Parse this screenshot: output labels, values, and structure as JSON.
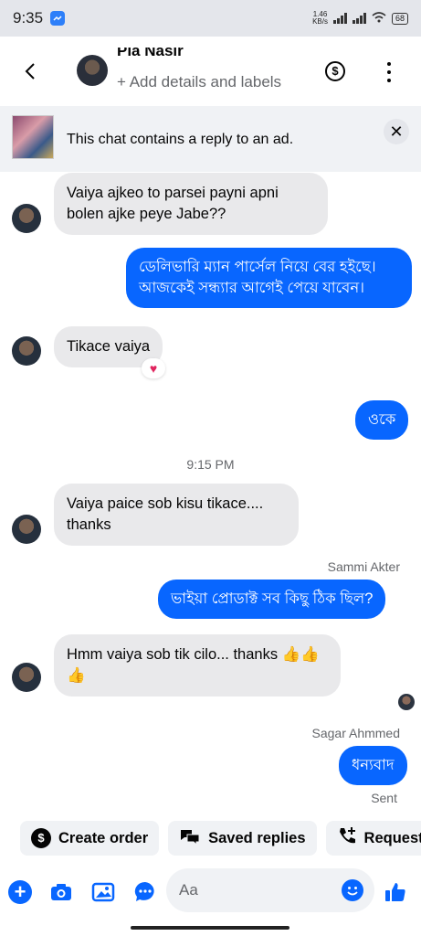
{
  "status": {
    "time": "9:35",
    "net_speed": "1.46\nKB/s",
    "battery": "68"
  },
  "header": {
    "name": "Pia Nasir",
    "subtitle": "+ Add details and labels"
  },
  "ad_banner": {
    "text": "This chat contains a reply to an ad.",
    "close": "✕"
  },
  "messages": {
    "m1": "Vaiya ajkeo to parsei payni   apni bolen ajke peye Jabe??",
    "m2": "ডেলিভারি ম্যান পার্সেল নিয়ে বের হইছে। আজকেই  সন্ধ্যার আগেই পেয়ে যাবেন।",
    "m3": "Tikace vaiya",
    "m3_reaction": "♥",
    "m4": "ওকে",
    "timestamp": "9:15 PM",
    "m5": "Vaiya paice sob kisu tikace.... thanks",
    "m6_sender": "Sammi Akter",
    "m6": "ভাইয়া প্রোডাক্ট সব কিছু ঠিক ছিল?",
    "m7": "Hmm vaiya sob tik cilo... thanks 👍👍👍",
    "m8_sender": "Sagar Ahmmed",
    "m8": "ধন্যবাদ",
    "m8_status": "Sent"
  },
  "chips": {
    "create_order": "Create order",
    "saved_replies": "Saved replies",
    "request": "Request"
  },
  "composer": {
    "placeholder": "Aa"
  },
  "colors": {
    "accent": "#0866ff",
    "incoming_bubble": "#e9e9eb"
  }
}
